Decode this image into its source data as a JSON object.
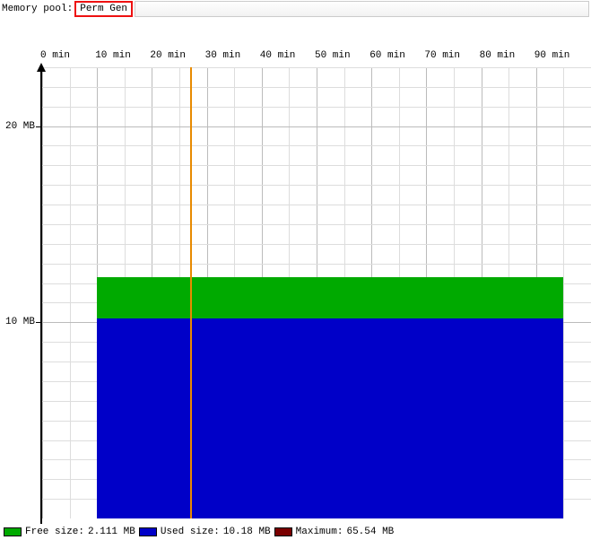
{
  "header": {
    "label": "Memory pool:",
    "selected_pool": "Perm Gen"
  },
  "chart_data": {
    "type": "area",
    "title": "",
    "xlabel": "",
    "ylabel": "",
    "x": [
      0,
      5,
      10,
      15,
      20,
      25,
      30,
      35,
      40,
      45,
      50,
      55,
      60,
      65,
      70,
      75,
      80,
      85,
      90,
      95
    ],
    "x_unit": "min",
    "x_tick_labels": [
      "0 min",
      "10 min",
      "20 min",
      "30 min",
      "40 min",
      "50 min",
      "60 min",
      "70 min",
      "80 min",
      "90 min"
    ],
    "x_minor_step": 5,
    "series": [
      {
        "name": "Used size",
        "color": "#0000c8",
        "values": [
          10.18,
          10.18,
          10.18,
          10.18,
          10.18,
          10.18,
          10.18,
          10.18,
          10.18,
          10.18,
          10.18,
          10.18,
          10.18,
          10.18,
          10.18,
          10.18,
          10.18,
          10.18,
          10.18,
          10.18
        ]
      },
      {
        "name": "Free size",
        "color": "#00aa00",
        "values": [
          2.111,
          2.111,
          2.111,
          2.111,
          2.111,
          2.111,
          2.111,
          2.111,
          2.111,
          2.111,
          2.111,
          2.111,
          2.111,
          2.111,
          2.111,
          2.111,
          2.111,
          2.111,
          2.111,
          2.111
        ]
      }
    ],
    "stacked_top": 12.291,
    "ylim": [
      0,
      23
    ],
    "y_unit": "MB",
    "y_tick_labels": [
      "10 MB",
      "20 MB"
    ],
    "y_tick_values": [
      10,
      20
    ],
    "y_minor_step": 1,
    "cursor_x": 27,
    "data_x_start": 10,
    "data_x_end": 95
  },
  "legend": {
    "free": {
      "label": "Free size:",
      "value": "2.111 MB"
    },
    "used": {
      "label": "Used size:",
      "value": "10.18 MB"
    },
    "max": {
      "label": "Maximum:",
      "value": "65.54 MB"
    }
  }
}
